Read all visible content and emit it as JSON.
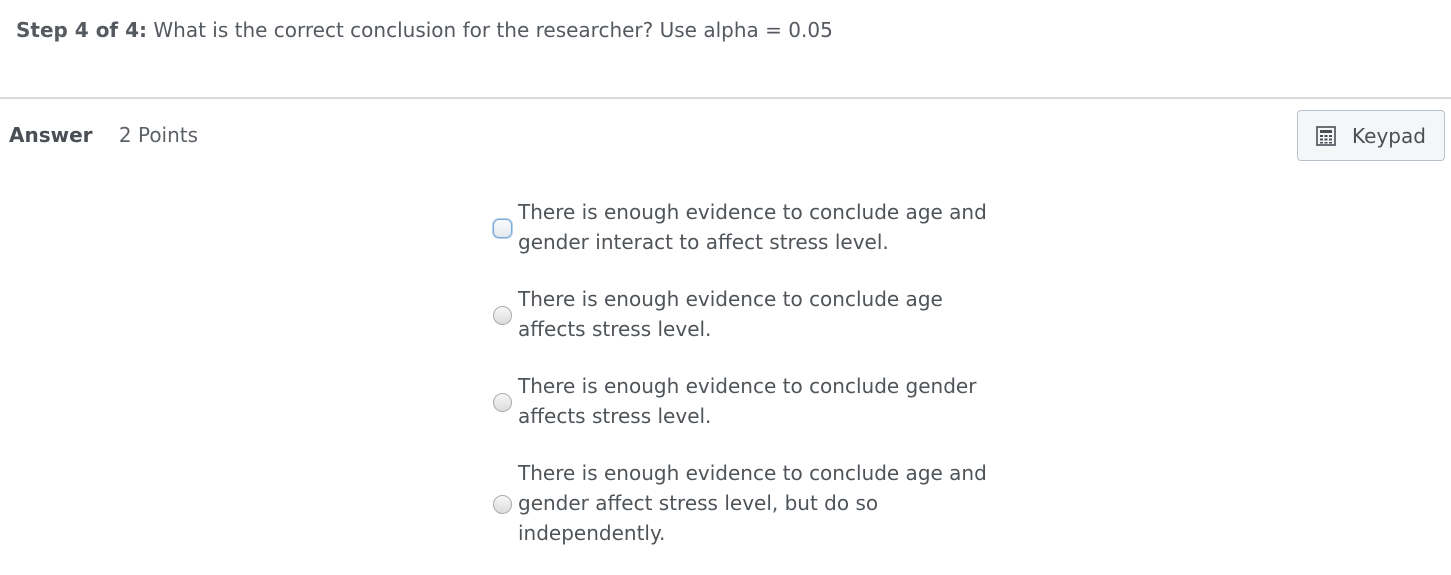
{
  "question": {
    "step": "Step 4 of 4:",
    "text": "What is the correct conclusion for the researcher?  Use alpha = 0.05"
  },
  "answer": {
    "label": "Answer",
    "points": "2 Points"
  },
  "keypad": {
    "label": "Keypad",
    "icon": "calculator-icon"
  },
  "options": [
    {
      "text": "There is enough evidence to conclude age and gender interact to affect stress level."
    },
    {
      "text": "There is enough evidence to conclude age affects stress level."
    },
    {
      "text": "There is enough evidence to conclude gender affects stress level."
    },
    {
      "text": "There is enough evidence to conclude age and gender affect stress level, but do so independently."
    }
  ]
}
